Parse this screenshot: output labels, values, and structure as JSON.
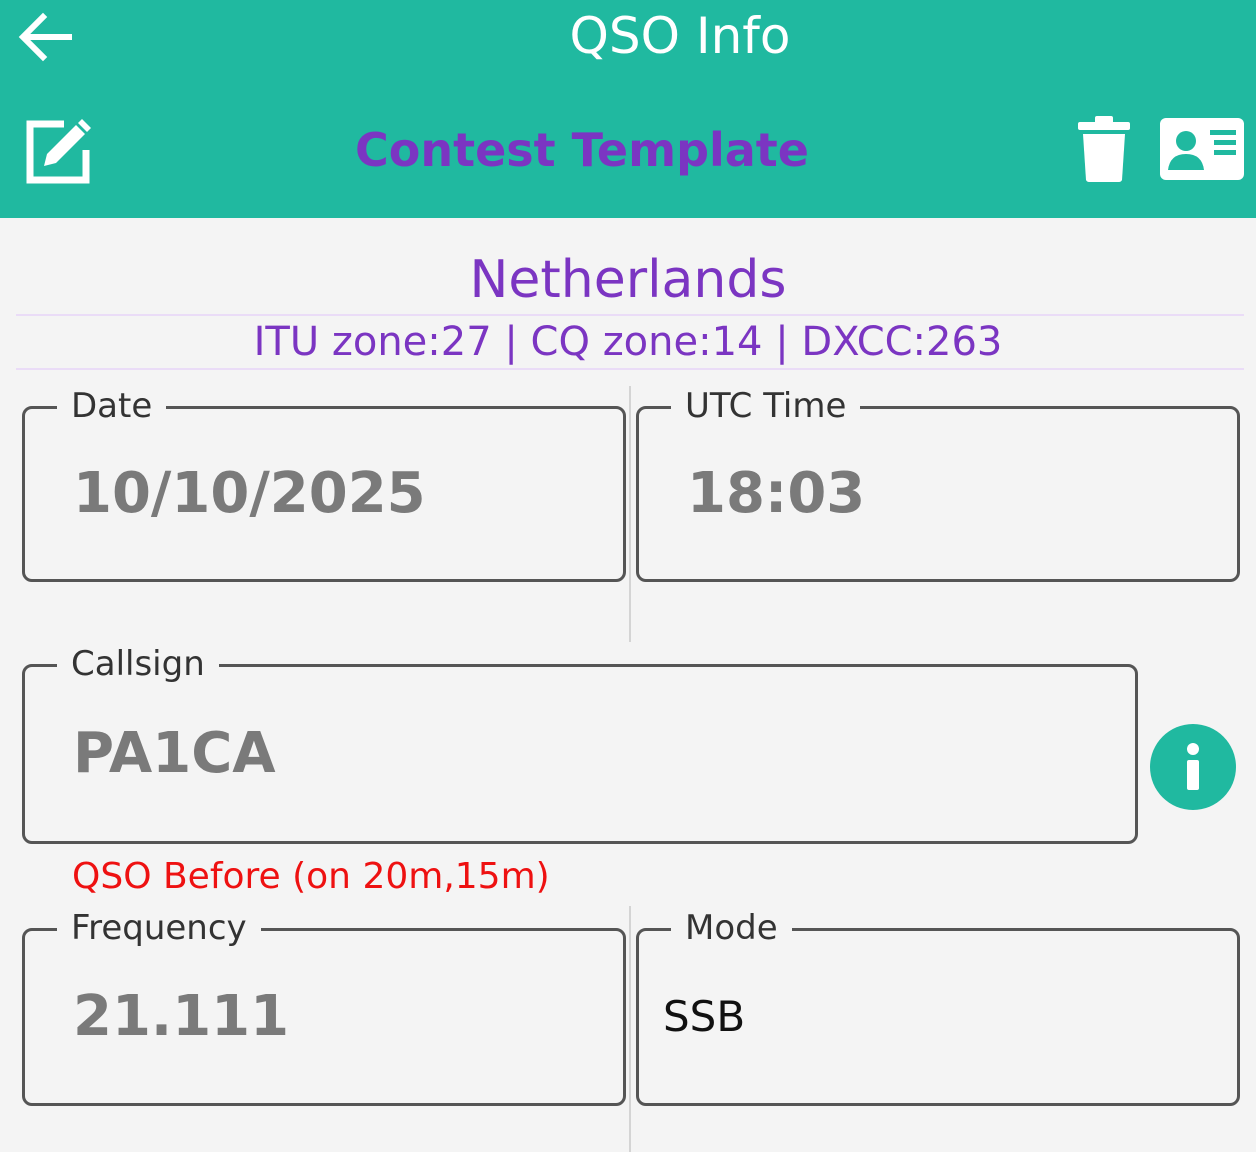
{
  "header": {
    "title": "QSO Info",
    "template_title": "Contest Template",
    "bg_color": "#20b9a0",
    "accent_color": "#7b35c2"
  },
  "location": {
    "country": "Netherlands",
    "zones": "ITU zone:27 | CQ zone:14 | DXCC:263"
  },
  "fields": {
    "date": {
      "label": "Date",
      "value": "10/10/2025"
    },
    "utc_time": {
      "label": "UTC Time",
      "value": "18:03"
    },
    "callsign": {
      "label": "Callsign",
      "value": "PA1CA"
    },
    "frequency": {
      "label": "Frequency",
      "value": "21.111"
    },
    "mode": {
      "label": "Mode",
      "value": "SSB"
    }
  },
  "qso_before": "QSO Before (on 20m,15m)",
  "icons": {
    "back": "arrow-left-icon",
    "edit": "edit-icon",
    "trash": "trash-icon",
    "card": "contact-card-icon",
    "info": "info-icon"
  }
}
